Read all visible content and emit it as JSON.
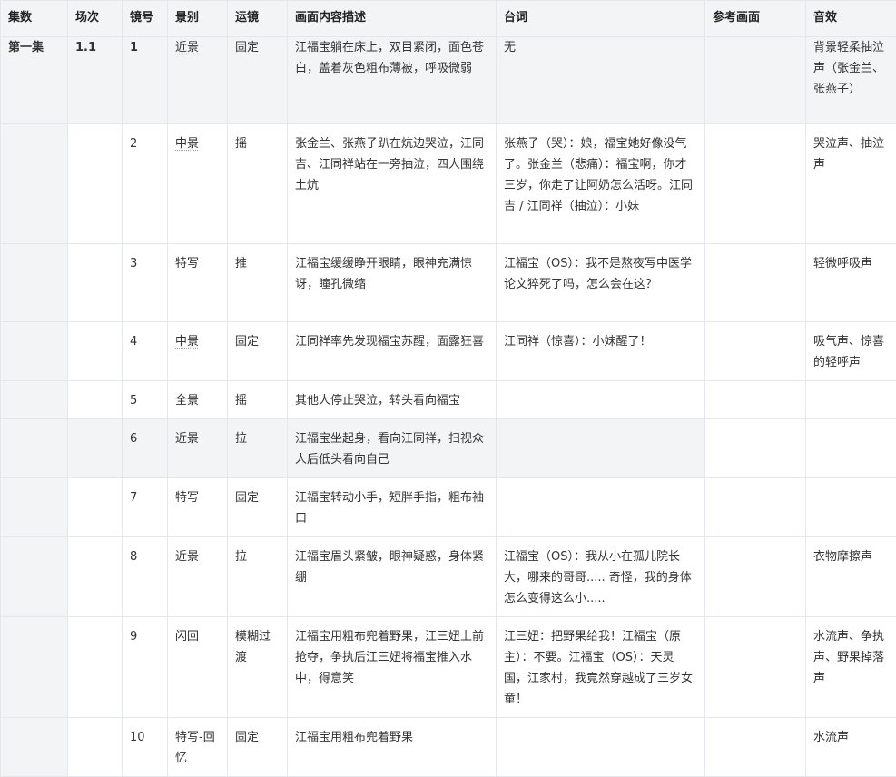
{
  "columns": [
    "集数",
    "场次",
    "镜号",
    "景别",
    "运镜",
    "画面内容描述",
    "台词",
    "参考画面",
    "音效"
  ],
  "rows": [
    {
      "episode": "第一集",
      "scene": "1.1",
      "shot": "1",
      "size": "近景",
      "move": "固定",
      "desc": "江福宝躺在床上，双目紧闭，面色苍白，盖着灰色粗布薄被，呼吸微弱",
      "line": "无",
      "ref": "",
      "sound": "背景轻柔抽泣声（张金兰、张燕子）"
    },
    {
      "episode": "",
      "scene": "",
      "shot": "2",
      "size": "中景",
      "move": "摇",
      "desc": "张金兰、张燕子趴在炕边哭泣，江同吉、江同祥站在一旁抽泣，四人围绕土炕",
      "line": "张燕子（哭）：娘，福宝她好像没气了。张金兰（悲痛）：福宝啊，你才三岁，你走了让阿奶怎么活呀。江同吉 / 江同祥（抽泣）：小妹",
      "ref": "",
      "sound": "哭泣声、抽泣声"
    },
    {
      "episode": "",
      "scene": "",
      "shot": "3",
      "size": "特写",
      "move": "推",
      "desc": "江福宝缓缓睁开眼睛，眼神充满惊讶，瞳孔微缩",
      "line": "江福宝（OS）：我不是熬夜写中医学论文猝死了吗，怎么会在这？",
      "ref": "",
      "sound": "轻微呼吸声"
    },
    {
      "episode": "",
      "scene": "",
      "shot": "4",
      "size": "中景",
      "move": "固定",
      "desc": "江同祥率先发现福宝苏醒，面露狂喜",
      "line": "江同祥（惊喜）：小妹醒了！",
      "ref": "",
      "sound": "吸气声、惊喜的轻呼声"
    },
    {
      "episode": "",
      "scene": "",
      "shot": "5",
      "size": "全景",
      "move": "摇",
      "desc": "其他人停止哭泣，转头看向福宝",
      "line": "",
      "ref": "",
      "sound": ""
    },
    {
      "episode": "",
      "scene": "",
      "shot": "6",
      "size": "近景",
      "move": "拉",
      "desc": "江福宝坐起身，看向江同祥，扫视众人后低头看向自己",
      "line": "",
      "ref": "",
      "sound": ""
    },
    {
      "episode": "",
      "scene": "",
      "shot": "7",
      "size": "特写",
      "move": "固定",
      "desc": "江福宝转动小手，短胖手指，粗布袖口",
      "line": "",
      "ref": "",
      "sound": ""
    },
    {
      "episode": "",
      "scene": "",
      "shot": "8",
      "size": "近景",
      "move": "拉",
      "desc": "江福宝眉头紧皱，眼神疑惑，身体紧绷",
      "line": "江福宝（OS）：我从小在孤儿院长大，哪来的哥哥..... 奇怪，我的身体怎么变得这么小.....",
      "ref": "",
      "sound": "衣物摩擦声"
    },
    {
      "episode": "",
      "scene": "",
      "shot": "9",
      "size": "闪回",
      "move": "模糊过渡",
      "desc": "江福宝用粗布兜着野果，江三妞上前抢夺，争执后江三妞将福宝推入水中，得意笑",
      "line": "江三妞：把野果给我！江福宝（原主）：不要。江福宝（OS）：天灵国，江家村，我竟然穿越成了三岁女童！",
      "ref": "",
      "sound": "水流声、争执声、野果掉落声"
    },
    {
      "episode": "",
      "scene": "",
      "shot": "10",
      "size": "特写-回忆",
      "move": "固定",
      "desc": "江福宝用粗布兜着野果",
      "line": "",
      "ref": "",
      "sound": "水流声"
    }
  ]
}
